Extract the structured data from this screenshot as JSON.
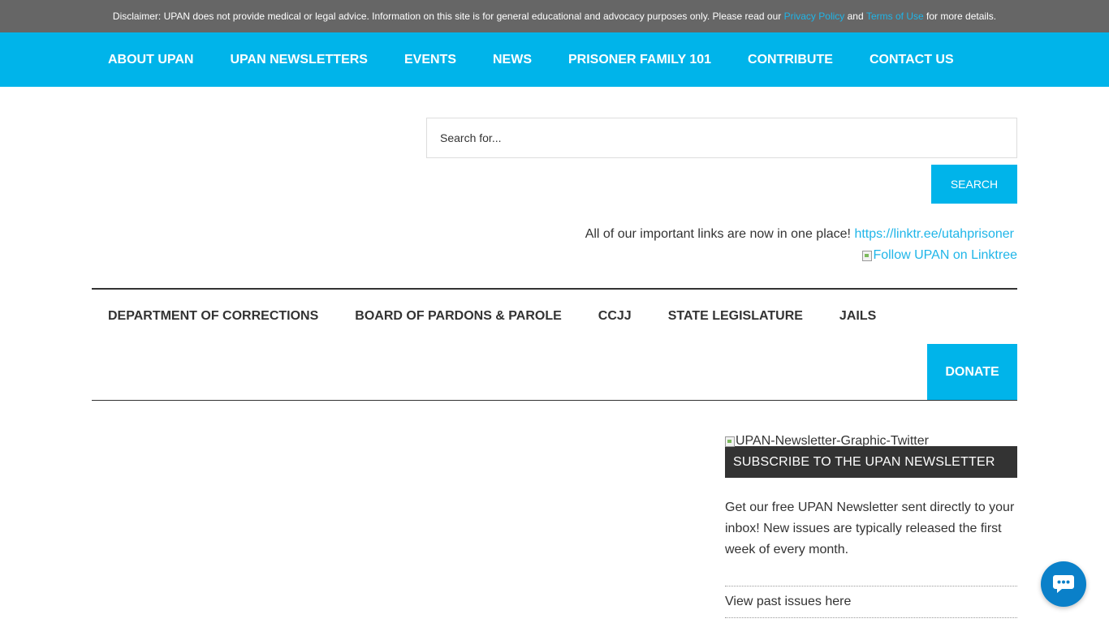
{
  "disclaimer": {
    "text_before": "Disclaimer: UPAN does not provide medical or legal advice. Information on this site is for general educational and advocacy purposes only. Please read our",
    "privacy_link": "Privacy Policy",
    "and_text": "and",
    "terms_link": "Terms of Use",
    "text_after": "for more details."
  },
  "top_nav": {
    "items": [
      "ABOUT UPAN",
      "UPAN NEWSLETTERS",
      "EVENTS",
      "NEWS",
      "PRISONER FAMILY 101",
      "CONTRIBUTE",
      "CONTACT US"
    ]
  },
  "search": {
    "placeholder": "Search for...",
    "button_label": "SEARCH"
  },
  "linktree": {
    "intro": "All of our important links are now in one place!",
    "url": "https://linktr.ee/utahprisoner",
    "follow_alt": "Follow UPAN on Linktree"
  },
  "secondary_nav": {
    "items": [
      "DEPARTMENT OF CORRECTIONS",
      "BOARD OF PARDONS & PAROLE",
      "CCJJ",
      "STATE LEGISLATURE",
      "JAILS"
    ],
    "donate_label": "DONATE"
  },
  "sidebar": {
    "graphic_alt": "UPAN-Newsletter-Graphic-Twitter",
    "subscribe_title": "SUBSCRIBE TO THE UPAN NEWSLETTER",
    "description": "Get our free UPAN Newsletter sent directly to your inbox! New issues are typically released the first week of every month.",
    "past_issues": "View past issues here"
  },
  "colors": {
    "accent": "#00b4ea",
    "link": "#1fb5e8",
    "disclaimer_bg": "#666666",
    "dark": "#333333",
    "chat": "#0a80c9"
  },
  "icons": {
    "chat": "chat-bubble-icon",
    "broken_image": "broken-image-icon"
  }
}
